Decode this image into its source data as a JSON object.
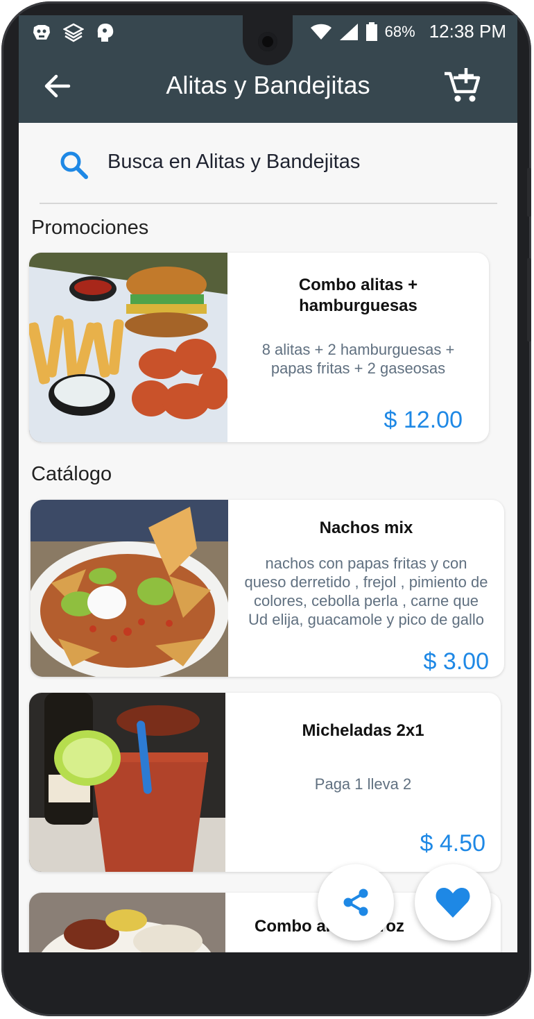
{
  "status_bar": {
    "battery": "68%",
    "time": "12:38 PM",
    "notification_icons": [
      "dog-icon",
      "layers-icon",
      "ghost-head-icon"
    ],
    "signal_icons": [
      "wifi-icon",
      "signal-icon",
      "battery-icon"
    ]
  },
  "header": {
    "title": "Alitas y Bandejitas",
    "back_icon": "arrow-left-icon",
    "cart_icon": "cart-add-icon",
    "bg_color": "#37474f"
  },
  "search": {
    "placeholder": "Busca en Alitas y Bandejitas",
    "icon": "search-icon",
    "accent": "#1e88e5"
  },
  "sections": {
    "promotions_label": "Promociones",
    "catalog_label": "Catálogo"
  },
  "promotions": [
    {
      "name_line1": "Combo alitas +",
      "name_line2": "hamburguesas",
      "desc_line1": "8 alitas + 2 hamburguesas +",
      "desc_line2": "papas fritas + 2 gaseosas",
      "price": "$ 12.00"
    }
  ],
  "catalog": [
    {
      "name": "Nachos mix",
      "desc_line1": "nachos con papas fritas y con",
      "desc_line2": "queso derretido , frejol , pimiento de",
      "desc_line3": "colores, cebolla perla , carne que",
      "desc_line4": "Ud elija, guacamole y pico de gallo",
      "price": "$ 3.00"
    },
    {
      "name": "Micheladas 2x1",
      "desc": "Paga 1 lleva 2",
      "price": "$ 4.50"
    },
    {
      "name": "Combo alitas arroz"
    }
  ],
  "actions": {
    "share_icon": "share-icon",
    "favorite_icon": "heart-icon",
    "favorite_color": "#1e88e5"
  }
}
